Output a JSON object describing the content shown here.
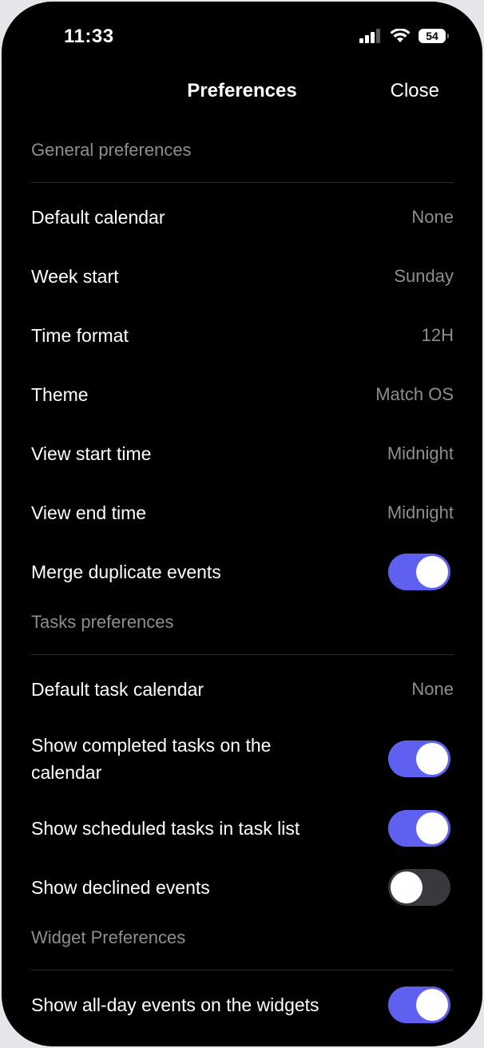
{
  "status_bar": {
    "time": "11:33",
    "battery": "54",
    "signal_icon": "cellular-signal-icon",
    "wifi_icon": "wifi-icon"
  },
  "nav": {
    "title": "Preferences",
    "close_label": "Close"
  },
  "colors": {
    "background": "#000000",
    "toggle_on": "#6060F0",
    "toggle_off": "#39393D",
    "secondary_text": "#8D8D92"
  },
  "general": {
    "header": "General preferences",
    "default_calendar": {
      "label": "Default calendar",
      "value": "None"
    },
    "week_start": {
      "label": "Week start",
      "value": "Sunday"
    },
    "time_format": {
      "label": "Time format",
      "value": "12H"
    },
    "theme": {
      "label": "Theme",
      "value": "Match OS"
    },
    "view_start_time": {
      "label": "View start time",
      "value": "Midnight"
    },
    "view_end_time": {
      "label": "View end time",
      "value": "Midnight"
    },
    "merge_duplicates": {
      "label": "Merge duplicate events",
      "enabled": true
    }
  },
  "tasks": {
    "header": "Tasks preferences",
    "default_task_calendar": {
      "label": "Default task calendar",
      "value": "None"
    },
    "show_completed": {
      "label": "Show completed tasks on the calendar",
      "enabled": true
    },
    "show_scheduled": {
      "label": "Show scheduled tasks in task list",
      "enabled": true
    },
    "show_declined": {
      "label": "Show declined events",
      "enabled": false
    }
  },
  "widget": {
    "header": "Widget Preferences",
    "show_all_day": {
      "label": "Show all-day events on the widgets",
      "enabled": true
    }
  }
}
